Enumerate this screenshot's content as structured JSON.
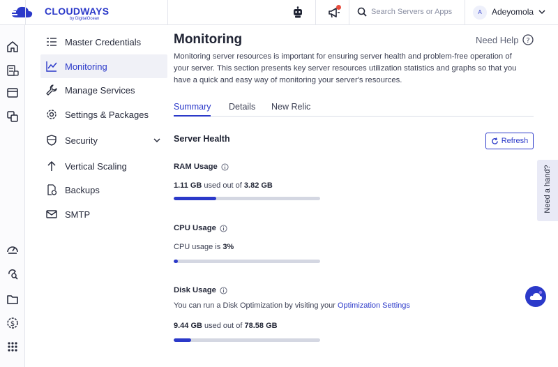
{
  "header": {
    "logo_text": "CLOUDWAYS",
    "logo_sub": "by DigitalOcean",
    "search_placeholder": "Search Servers or Apps",
    "user_initial": "A",
    "user_name": "Adeyomola"
  },
  "subnav": {
    "items": [
      {
        "label": "Master Credentials",
        "icon": "list-icon"
      },
      {
        "label": "Monitoring",
        "icon": "chart-icon",
        "active": true
      },
      {
        "label": "Manage Services",
        "icon": "wrench-icon"
      },
      {
        "label": "Settings & Packages",
        "icon": "gear-icon"
      },
      {
        "label": "Security",
        "icon": "shield-icon"
      },
      {
        "label": "Vertical Scaling",
        "icon": "arrow-up-icon"
      },
      {
        "label": "Backups",
        "icon": "backup-icon"
      },
      {
        "label": "SMTP",
        "icon": "mail-icon"
      }
    ]
  },
  "main": {
    "title": "Monitoring",
    "help_label": "Need Help",
    "description": "Monitoring server resources is important for ensuring server health and problem-free operation of your server. This section presents key server resources utilization statistics and graphs so that you have a quick and easy way of monitoring your server's resources.",
    "tabs": [
      "Summary",
      "Details",
      "New Relic"
    ],
    "active_tab": "Summary",
    "section_title": "Server Health",
    "refresh_label": "Refresh",
    "ram": {
      "label": "RAM Usage",
      "used": "1.11 GB",
      "middle": " used out of ",
      "total": "3.82 GB",
      "fraction": 0.29
    },
    "cpu": {
      "label": "CPU Usage",
      "prefix": "CPU usage is ",
      "value": "3%",
      "fraction": 0.03
    },
    "disk": {
      "label": "Disk Usage",
      "hint_prefix": "You can run a Disk Optimization by visiting your ",
      "hint_link": "Optimization Settings",
      "used": "9.44 GB",
      "middle": " used out of ",
      "total": "78.58 GB",
      "fraction": 0.12
    }
  },
  "floating": {
    "need_hand": "Need a hand?"
  },
  "colors": {
    "accent": "#2b39c9",
    "alert_dot": "#e74c3c",
    "bar_track": "#d4d7e2"
  }
}
